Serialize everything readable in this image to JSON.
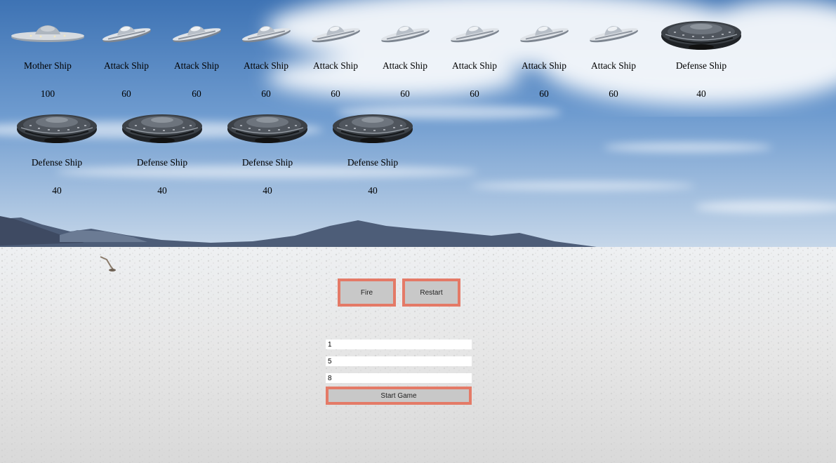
{
  "fleet": {
    "row1": [
      {
        "name": "Mother Ship",
        "hp": "100",
        "kind": "mother"
      },
      {
        "name": "Attack Ship",
        "hp": "60",
        "kind": "attack"
      },
      {
        "name": "Attack Ship",
        "hp": "60",
        "kind": "attack"
      },
      {
        "name": "Attack Ship",
        "hp": "60",
        "kind": "attack"
      },
      {
        "name": "Attack Ship",
        "hp": "60",
        "kind": "attack"
      },
      {
        "name": "Attack Ship",
        "hp": "60",
        "kind": "attack"
      },
      {
        "name": "Attack Ship",
        "hp": "60",
        "kind": "attack"
      },
      {
        "name": "Attack Ship",
        "hp": "60",
        "kind": "attack"
      },
      {
        "name": "Attack Ship",
        "hp": "60",
        "kind": "attack"
      },
      {
        "name": "Defense Ship",
        "hp": "40",
        "kind": "defense"
      }
    ],
    "row2": [
      {
        "name": "Defense Ship",
        "hp": "40",
        "kind": "defense"
      },
      {
        "name": "Defense Ship",
        "hp": "40",
        "kind": "defense"
      },
      {
        "name": "Defense Ship",
        "hp": "40",
        "kind": "defense"
      },
      {
        "name": "Defense Ship",
        "hp": "40",
        "kind": "defense"
      }
    ]
  },
  "controls": {
    "fire_label": "Fire",
    "restart_label": "Restart",
    "start_label": "Start Game"
  },
  "inputs": {
    "field1": "1",
    "field2": "5",
    "field3": "8"
  },
  "colors": {
    "button_border": "#e47a67",
    "button_fill": "#c8c8c8"
  }
}
